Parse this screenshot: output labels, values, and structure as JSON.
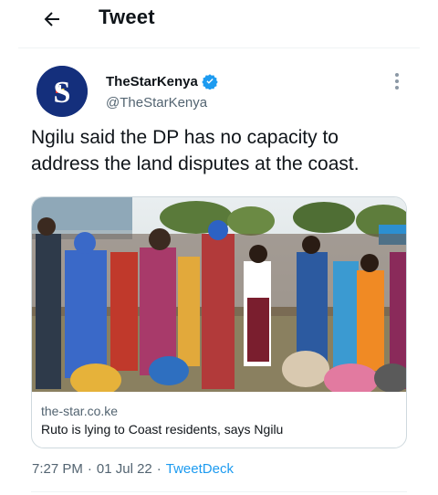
{
  "header": {
    "title": "Tweet",
    "back_icon": "arrow-left-icon"
  },
  "tweet": {
    "author": {
      "display_name": "TheStarKenya",
      "handle": "@TheStarKenya",
      "verified": true,
      "avatar_letter": "S",
      "avatar_color": "#142f7c"
    },
    "text": "Ngilu said the DP has no capacity to address the land disputes at the coast.",
    "card": {
      "domain": "the-star.co.ke",
      "title": "Ruto is lying to Coast residents, says Ngilu"
    },
    "time": "7:27 PM",
    "separator": "·",
    "date": "01 Jul 22",
    "source": "TweetDeck"
  },
  "colors": {
    "accent": "#1d9bf0",
    "secondary_text": "#536471",
    "border": "#cfd9de"
  }
}
